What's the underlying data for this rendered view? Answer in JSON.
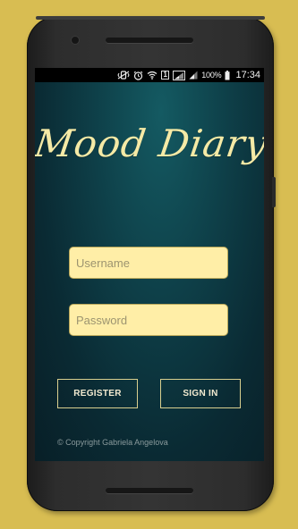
{
  "colors": {
    "background": "#d8bd52",
    "accent_text": "#f5eaa6",
    "input_fill": "#ffeea7",
    "app_gradient_top": "#145a62",
    "app_gradient_bottom": "#081f27"
  },
  "status_bar": {
    "icons": [
      "vibrate-icon",
      "alarm-icon",
      "wifi-icon",
      "sim-icon",
      "signal-1-icon",
      "signal-2-icon",
      "battery-icon"
    ],
    "sim_label": "1",
    "battery_percent": "100%",
    "time": "17:34"
  },
  "app": {
    "title": "Mood Diary",
    "username": {
      "value": "",
      "placeholder": "Username"
    },
    "password": {
      "value": "",
      "placeholder": "Password"
    },
    "register_label": "REGISTER",
    "signin_label": "SIGN IN",
    "copyright": "© Copyright Gabriela Angelova"
  }
}
